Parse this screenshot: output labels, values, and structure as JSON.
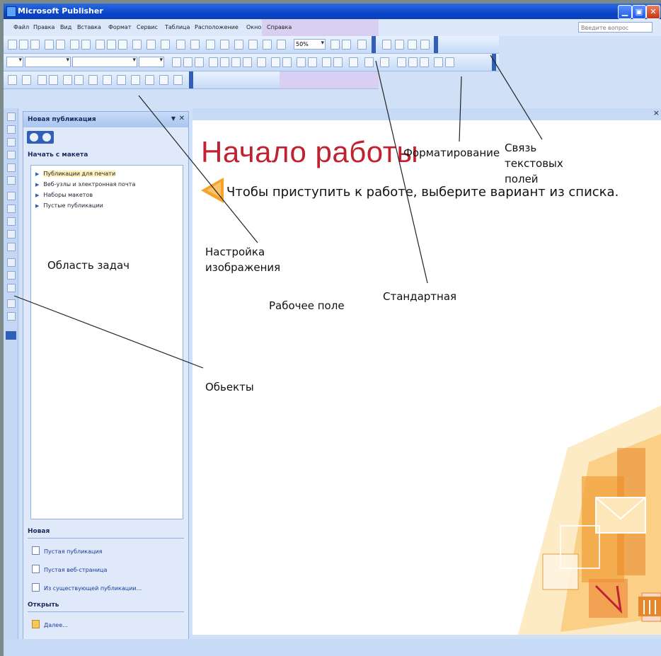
{
  "window": {
    "title": "Microsoft Publisher"
  },
  "menu": {
    "items": [
      "Файл",
      "Правка",
      "Вид",
      "Вставка",
      "Формат",
      "Сервис",
      "Таблица",
      "Расположение",
      "Окно",
      "Справка"
    ],
    "ask_placeholder": "Введите вопрос"
  },
  "toolbar": {
    "zoom_value": "50%"
  },
  "task_pane": {
    "title": "Новая публикация",
    "section_start": "Начать с макета",
    "items": [
      "Публикации для печати",
      "Веб-узлы и электронная почта",
      "Наборы макетов",
      "Пустые публикации"
    ],
    "section_new": "Новая",
    "new_links": [
      "Пустая публикация",
      "Пустая веб-страница",
      "Из существующей публикации..."
    ],
    "section_open": "Открыть",
    "open_link": "Далее..."
  },
  "workspace": {
    "title": "Начало работы",
    "instruction": "Чтобы приступить к работе, выберите вариант из списка."
  },
  "callouts": {
    "formatting": "Форматирование",
    "text_link": "Связь текстовых полей",
    "picture_settings": "Настройка изображения",
    "task_area": "Область задач",
    "work_field": "Рабочее поле",
    "standard": "Стандартная",
    "objects": "Обьекты"
  },
  "colors": {
    "title_red": "#c0232f",
    "xp_blue": "#0a46c9",
    "pane_blue": "#dfe9fa"
  }
}
